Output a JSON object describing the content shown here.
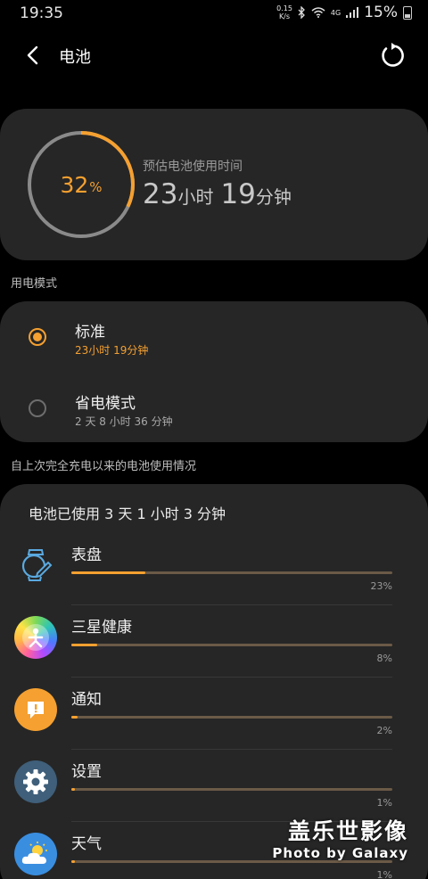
{
  "status_bar": {
    "time": "19:35",
    "speed_value": "0.15",
    "speed_unit": "K/s",
    "network": "4G",
    "battery_percent": "15%"
  },
  "header": {
    "title": "电池"
  },
  "battery": {
    "percent": "32",
    "percent_symbol": "%",
    "level": 32,
    "estimate_label": "预估电池使用时间",
    "estimate_hours": "23",
    "hours_unit": "小时",
    "estimate_minutes": "19",
    "minutes_unit": "分钟"
  },
  "power_mode": {
    "section_label": "用电模式",
    "options": [
      {
        "name": "标准",
        "detail": "23小时 19分钟",
        "selected": true
      },
      {
        "name": "省电模式",
        "detail": "2 天 8 小时 36 分钟",
        "selected": false
      }
    ]
  },
  "usage": {
    "section_label": "自上次完全充电以来的电池使用情况",
    "title": "电池已使用 3 天 1 小时 3 分钟",
    "apps": [
      {
        "name": "表盘",
        "percent_label": "23%",
        "percent": 23,
        "icon": "watch-face-icon"
      },
      {
        "name": "三星健康",
        "percent_label": "8%",
        "percent": 8,
        "icon": "samsung-health-icon"
      },
      {
        "name": "通知",
        "percent_label": "2%",
        "percent": 2,
        "icon": "notification-icon"
      },
      {
        "name": "设置",
        "percent_label": "1%",
        "percent": 1,
        "icon": "settings-gear-icon"
      },
      {
        "name": "天气",
        "percent_label": "1%",
        "percent": 1,
        "icon": "weather-icon"
      }
    ]
  },
  "watermark": {
    "line1": "盖乐世影像",
    "line2": "Photo by Galaxy"
  },
  "colors": {
    "accent": "#f5a030",
    "card": "#262626",
    "track": "#6b5a47"
  }
}
